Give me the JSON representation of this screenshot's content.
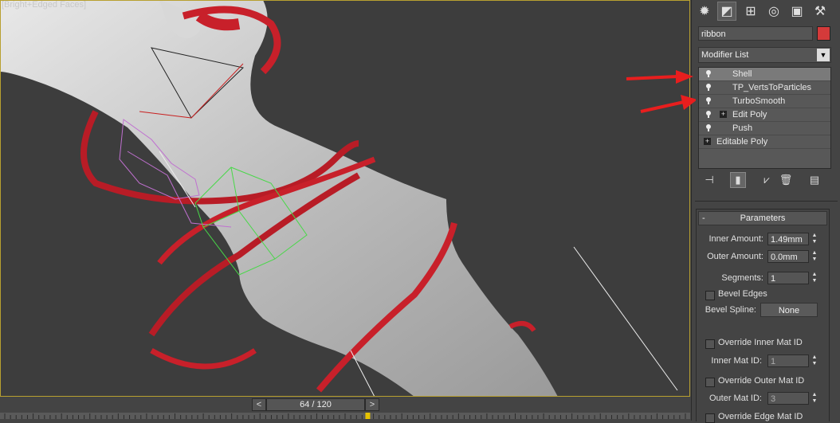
{
  "viewport": {
    "label": "[Bright+Edged Faces]"
  },
  "panel": {
    "tabs": [
      "create-tab",
      "modify-tab",
      "hierarchy-tab",
      "motion-tab",
      "display-tab",
      "utilities-tab"
    ],
    "object_name": "ribbon",
    "object_color": "#d43a3a",
    "modifier_list": "Modifier List",
    "stack": [
      {
        "label": "Shell",
        "selected": true
      },
      {
        "label": "TP_VertsToParticles",
        "selected": false
      },
      {
        "label": "TurboSmooth",
        "selected": false
      },
      {
        "label": "Edit Poly",
        "selected": false
      },
      {
        "label": "Push",
        "selected": false
      },
      {
        "label": "Editable Poly",
        "selected": false
      }
    ],
    "parameters": {
      "title": "Parameters",
      "inner_amount_label": "Inner Amount:",
      "inner_amount": "1.49mm",
      "outer_amount_label": "Outer Amount:",
      "outer_amount": "0.0mm",
      "segments_label": "Segments:",
      "segments": "1",
      "bevel_edges": "Bevel Edges",
      "bevel_spline_label": "Bevel Spline:",
      "bevel_spline": "None",
      "override_inner": "Override Inner Mat ID",
      "inner_mat_label": "Inner Mat ID:",
      "inner_mat": "1",
      "override_outer": "Override Outer Mat ID",
      "outer_mat_label": "Outer Mat ID:",
      "outer_mat": "3",
      "override_edge": "Override Edge Mat ID"
    }
  },
  "timeline": {
    "frame": "64 / 120",
    "prev": "<",
    "next": ">",
    "current": 64,
    "total": 120
  },
  "colors": {
    "accent": "#d43a3a",
    "arrow": "#e81e1e"
  }
}
